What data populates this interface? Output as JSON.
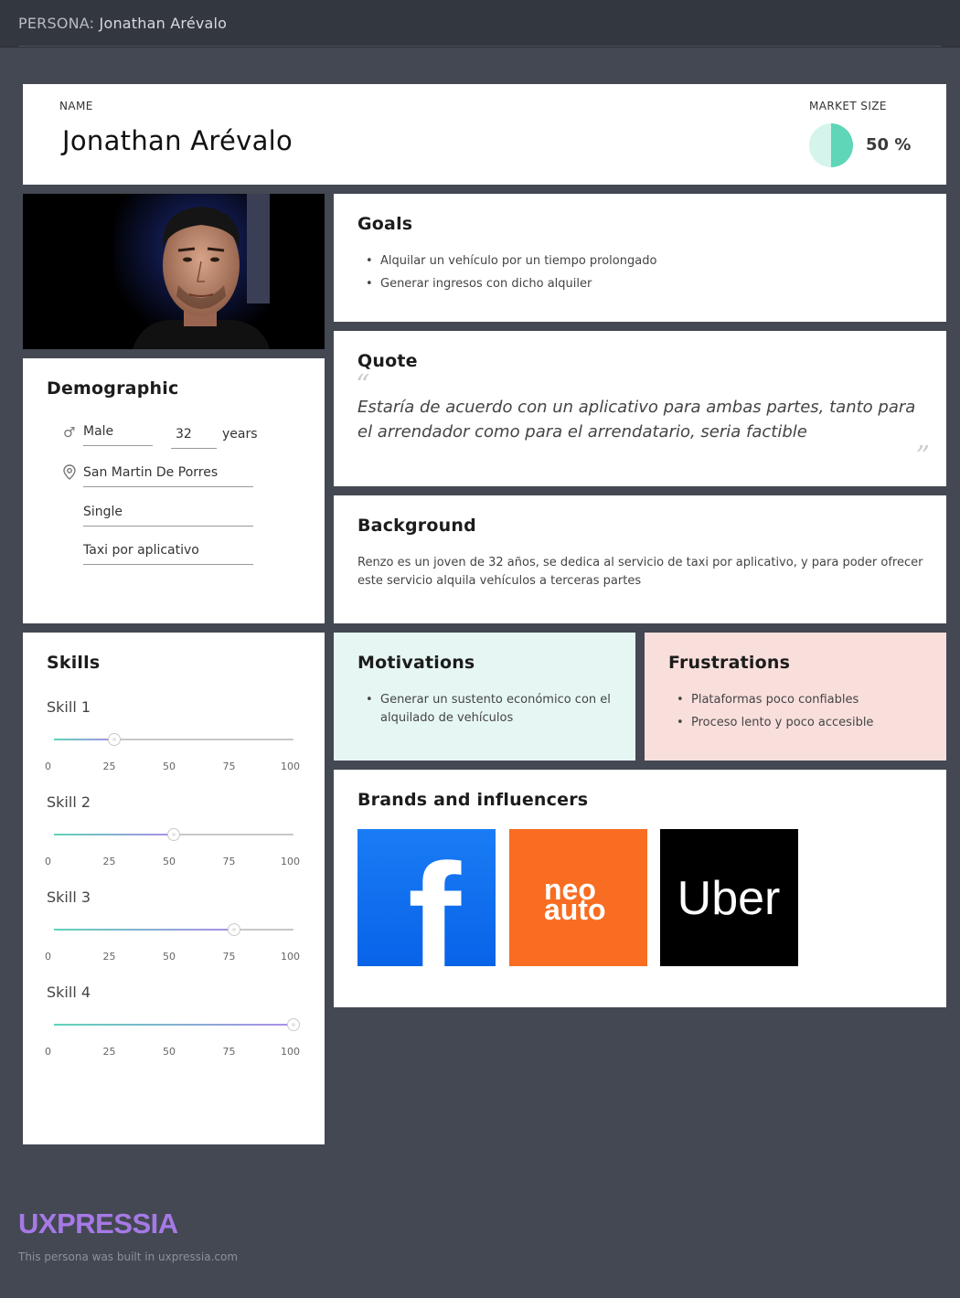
{
  "header": {
    "prefix": "PERSONA:",
    "name": "Jonathan Arévalo"
  },
  "name_card": {
    "name_label": "NAME",
    "name": "Jonathan Arévalo",
    "market_size_label": "MARKET SIZE",
    "market_size_value": 50,
    "market_size_text": "50 %"
  },
  "photo": {
    "description": ""
  },
  "demographic": {
    "title": "Demographic",
    "gender": "Male",
    "age": "32",
    "age_unit": "years",
    "location": "San Martin De Porres",
    "status": "Single",
    "occupation": "Taxi por aplicativo"
  },
  "goals": {
    "title": "Goals",
    "items": [
      "Alquilar un vehículo por un tiempo prolongado",
      "Generar ingresos con dicho alquiler"
    ]
  },
  "quote": {
    "title": "Quote",
    "text": "Estaría de acuerdo con un aplicativo para ambas partes, tanto para el arrendador como para el arrendatario, seria factible"
  },
  "background": {
    "title": "Background",
    "text": "Renzo es un joven de 32 años, se dedica al servicio de taxi por aplicativo, y para poder ofrecer este servicio alquila vehículos a terceras partes"
  },
  "skills": {
    "title": "Skills",
    "ticks": [
      "0",
      "25",
      "50",
      "75",
      "100"
    ],
    "items": [
      {
        "label": "Skill 1",
        "value": 25
      },
      {
        "label": "Skill 2",
        "value": 50
      },
      {
        "label": "Skill 3",
        "value": 75
      },
      {
        "label": "Skill 4",
        "value": 100
      }
    ]
  },
  "motivations": {
    "title": "Motivations",
    "items": [
      "Generar un sustento económico con el alquilado de vehículos"
    ]
  },
  "frustrations": {
    "title": "Frustrations",
    "items": [
      "Plataformas poco confiables",
      "Proceso lento y poco accesible"
    ]
  },
  "brands": {
    "title": "Brands and influencers",
    "logos": [
      {
        "name": "facebook-logo",
        "text": "f",
        "color": "#1877f2"
      },
      {
        "name": "neoauto-logo",
        "text_line1": "neo",
        "text_line2": "auto",
        "color": "#f86d21"
      },
      {
        "name": "uber-logo",
        "text": "Uber",
        "color": "#000000"
      }
    ]
  },
  "footer": {
    "brand": "UXPRESSIA",
    "note": "This persona was built in uxpressia.com"
  },
  "colors": {
    "background": "#434852",
    "topbar": "#33373f",
    "motivations_bg": "#e6f7f3",
    "frustrations_bg": "#f9dfdc",
    "market_teal": "#5ed6b7",
    "market_light": "#d4f4ec",
    "footer_brand": "#a679e6"
  }
}
